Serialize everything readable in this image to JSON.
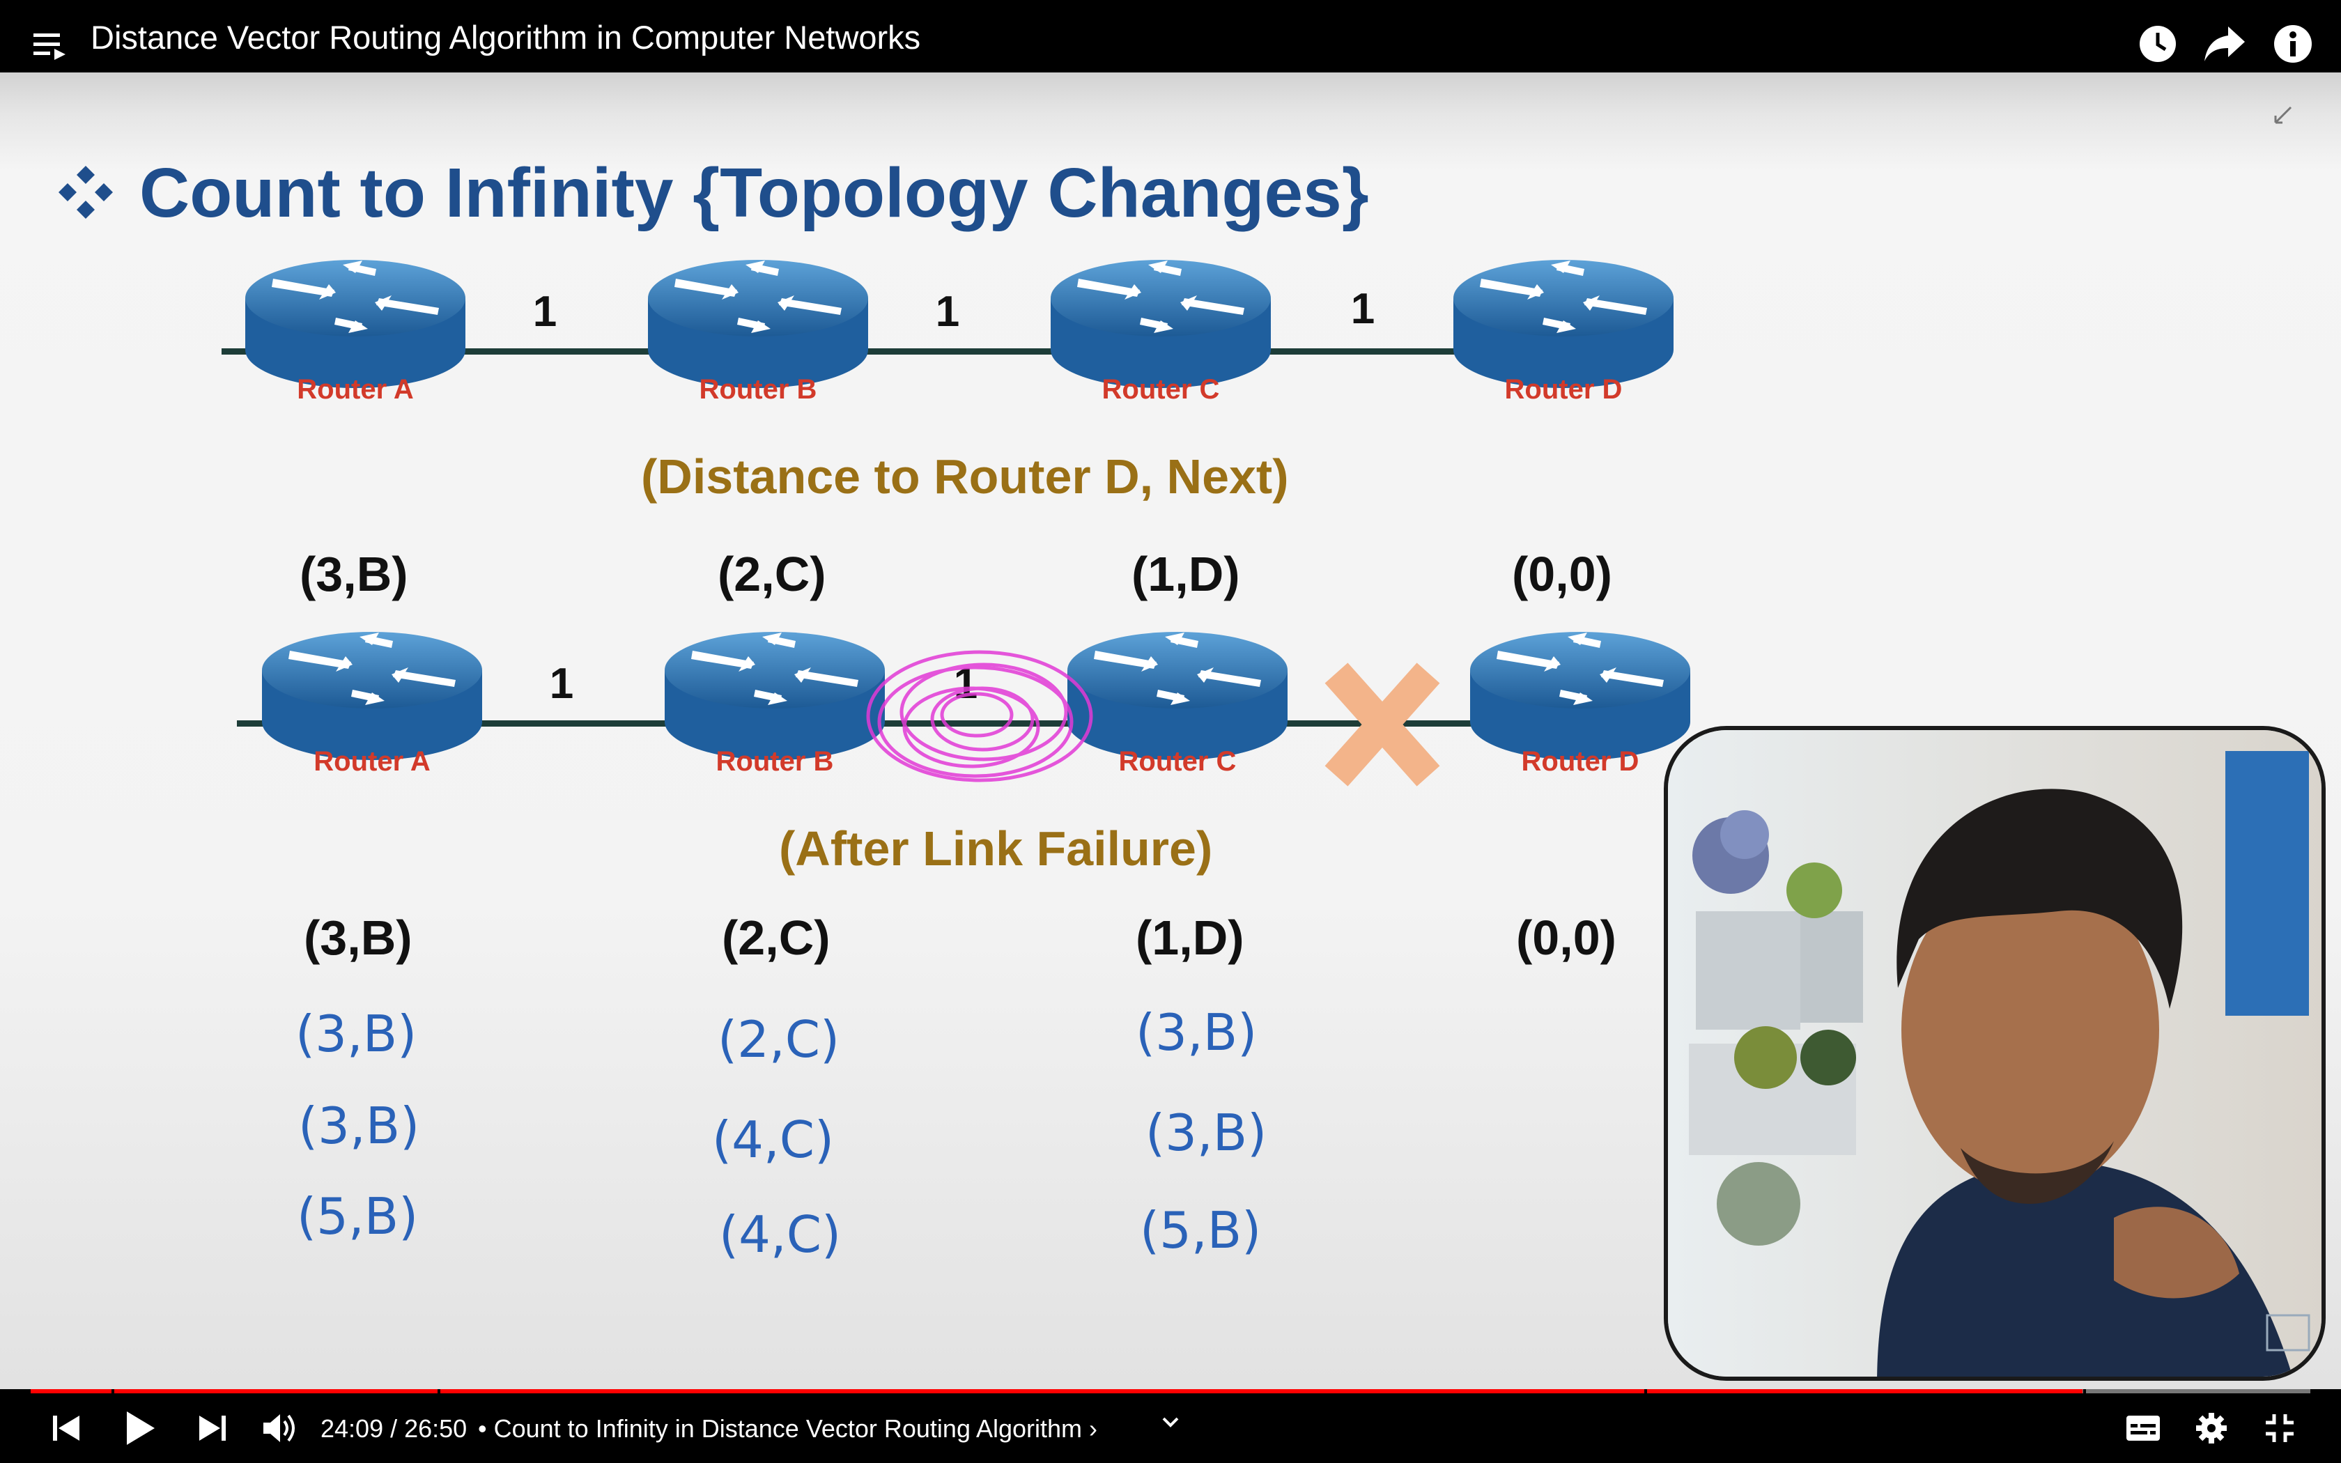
{
  "header": {
    "title": "Distance Vector Routing Algorithm in Computer Networks",
    "icons": [
      "playlist-icon",
      "watch-later-icon",
      "share-icon",
      "info-icon"
    ]
  },
  "slide": {
    "title": "Count to Infinity {Topology Changes}",
    "top_routers": [
      "Router A",
      "Router B",
      "Router C",
      "Router D"
    ],
    "top_link_costs": [
      "1",
      "1",
      "1"
    ],
    "distance_caption": "(Distance to Router D, Next)",
    "table1": [
      "(3,B)",
      "(2,C)",
      "(1,D)",
      "(0,0)"
    ],
    "bottom_routers": [
      "Router A",
      "Router B",
      "Router C",
      "Router D"
    ],
    "bottom_link_costs": [
      "1",
      "1"
    ],
    "failure_caption": "(After Link Failure)",
    "table2": [
      "(3,B)",
      "(2,C)",
      "(1,D)",
      "(0,0)"
    ],
    "handwritten": {
      "rows": [
        [
          "(3,B)",
          "(2,C)",
          "(3,B)"
        ],
        [
          "(3,B)",
          "(4,C)",
          "(3,B)"
        ],
        [
          "(5,B)",
          "(4,C)",
          "(5,B)"
        ]
      ]
    }
  },
  "player": {
    "time": "24:09 / 26:50",
    "chapter": "• Count to Infinity in Distance Vector Routing Algorithm ›",
    "progress_fraction": 0.9,
    "accent": "#ff0000"
  }
}
